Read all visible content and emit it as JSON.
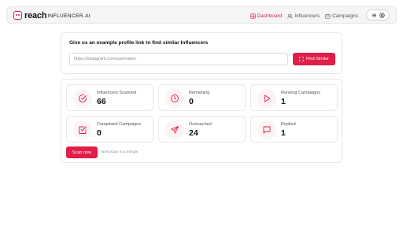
{
  "brand": {
    "name_bold": "reach",
    "name_rest": "INFLUENCER.AI"
  },
  "nav": {
    "items": [
      {
        "label": "Dashboard",
        "icon": "dashboard-icon",
        "active": true
      },
      {
        "label": "Influencers",
        "icon": "users-icon",
        "active": false
      },
      {
        "label": "Campaigns",
        "icon": "calendar-icon",
        "active": false
      }
    ]
  },
  "search": {
    "prompt": "Give us an example profile link to find similar Influencers",
    "placeholder": "https://instagram.com/username",
    "value": "",
    "button_label": "Find Similar"
  },
  "stats": [
    {
      "label": "Influencers Scanned",
      "value": "66",
      "icon": "check-circle-icon"
    },
    {
      "label": "Remaining",
      "value": "0",
      "icon": "clock-icon"
    },
    {
      "label": "Running Campaigns",
      "value": "1",
      "icon": "play-icon"
    },
    {
      "label": "Completed Campaigns",
      "value": "0",
      "icon": "check-square-icon"
    },
    {
      "label": "Outreached",
      "value": "24",
      "icon": "send-icon"
    },
    {
      "label": "Replied",
      "value": "1",
      "icon": "message-icon"
    }
  ],
  "scan": {
    "button_label": "Scan now",
    "note": "Next scan in a minute"
  },
  "colors": {
    "accent": "#e11d48",
    "icon_bg": "#fcf3f5"
  }
}
